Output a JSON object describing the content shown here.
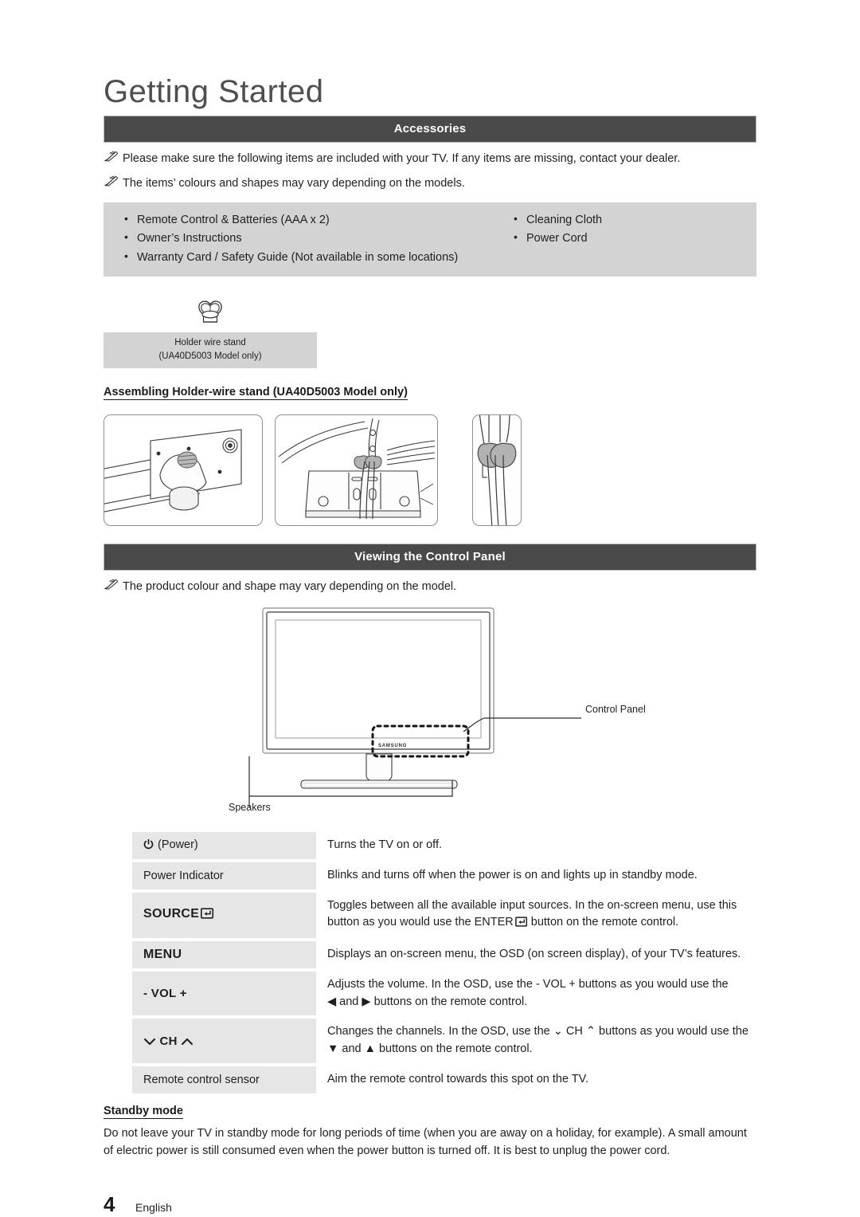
{
  "page": {
    "title": "Getting Started",
    "footer_number": "4",
    "footer_language": "English"
  },
  "accessories": {
    "bar_title": "Accessories",
    "notes": [
      "Please make sure the following items are included with your TV. If any items are missing, contact your dealer.",
      "The items’ colours and shapes may vary depending on the models."
    ],
    "items_left": [
      "Remote Control & Batteries (AAA x 2)",
      "Owner’s Instructions",
      "Warranty Card / Safety Guide (Not available in some locations)"
    ],
    "items_right": [
      "Cleaning Cloth",
      "Power Cord"
    ],
    "holder_caption_line1": "Holder wire stand",
    "holder_caption_line2": "(UA40D5003 Model only)",
    "assembling_subhead": "Assembling Holder-wire stand (UA40D5003 Model only)"
  },
  "control_panel": {
    "bar_title": "Viewing the Control Panel",
    "note": "The product colour and shape may vary depending on the model.",
    "diagram_labels": {
      "control_panel": "Control Panel",
      "speakers": "Speakers",
      "brand": "SAMSUNG"
    },
    "rows": [
      {
        "name": "(Power)",
        "icon": "power-icon",
        "desc_lines": [
          "Turns the TV on or off."
        ]
      },
      {
        "name": "Power Indicator",
        "icon": "",
        "desc_lines": [
          "Blinks and turns off when the power is on and lights up in standby mode."
        ]
      },
      {
        "name": "SOURCE",
        "icon": "enter-icon",
        "desc_lines": [
          "Toggles between all the available input sources. In the on-screen menu, use this",
          "button as you would use the ENTER",
          " button on the remote control."
        ]
      },
      {
        "name": "MENU",
        "icon": "",
        "desc_lines": [
          "Displays an on-screen menu, the OSD (on screen display), of your TV’s features."
        ]
      },
      {
        "name": "- VOL +",
        "icon": "",
        "desc_lines": [
          "Adjusts the volume. In the OSD, use the  - VOL + buttons as you would use the",
          "◀ and ▶ buttons on the remote control."
        ]
      },
      {
        "name": "CH",
        "icon": "ch-chevrons-icon",
        "desc_lines": [
          "Changes the channels. In the OSD, use the ⌄ CH ⌃ buttons as you would use the",
          "▼ and ▲ buttons on the remote control."
        ]
      },
      {
        "name": "Remote control sensor",
        "icon": "",
        "desc_lines": [
          "Aim the remote control towards this spot on the TV."
        ]
      }
    ]
  },
  "standby": {
    "heading": "Standby mode",
    "body": "Do not leave your TV in standby mode for long periods of time (when you are away on a holiday, for example). A small amount of electric power is still consumed even when the power button is turned off. It is best to unplug the power cord."
  },
  "colors": {
    "bar_bg": "#4a4a4a",
    "accessory_box_bg": "#d3d3d3",
    "table_name_bg": "#e6e6e6",
    "table_swatch_bg": "#c2c2c2",
    "title_color": "#4f4f4f"
  }
}
